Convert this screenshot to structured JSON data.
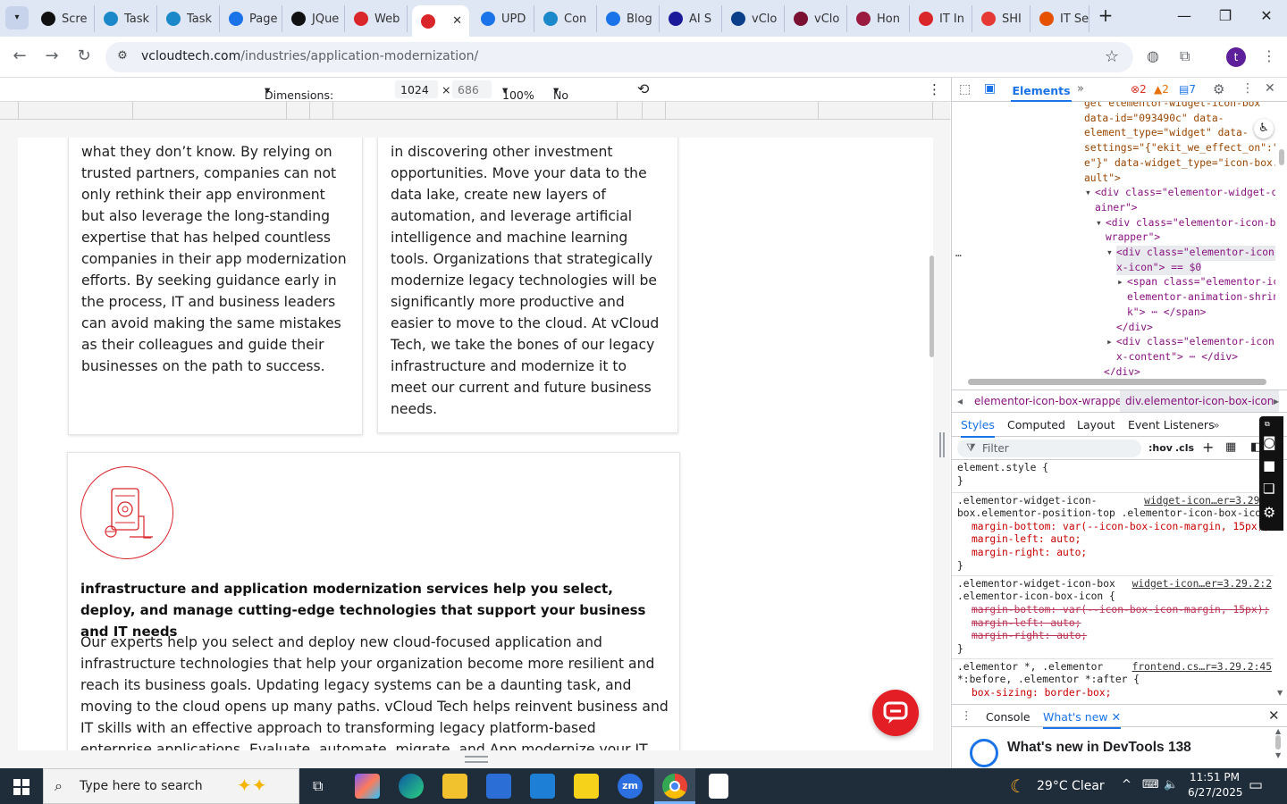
{
  "tabs": [
    {
      "label": "Scre",
      "icon": "github-icon",
      "color": "#111111"
    },
    {
      "label": "Task",
      "icon": "task-hexagon-icon",
      "color": "#1a88c9"
    },
    {
      "label": "Task",
      "icon": "task-hexagon-icon",
      "color": "#1a88c9"
    },
    {
      "label": "Page",
      "icon": "pagespeed-icon",
      "color": "#1a73e8"
    },
    {
      "label": "JQue",
      "icon": "threads-icon",
      "color": "#111111"
    },
    {
      "label": "Web",
      "icon": "vcloud-logo-icon",
      "color": "#d9262b"
    },
    {
      "label": "",
      "icon": "vcloud-logo-icon",
      "color": "#d9262b"
    },
    {
      "label": "UPD",
      "icon": "document-icon",
      "color": "#1a73e8"
    },
    {
      "label": "Con",
      "icon": "hexagon-icon",
      "color": "#1a88c9"
    },
    {
      "label": "Blog",
      "icon": "scale-icon",
      "color": "#1a73e8"
    },
    {
      "label": "AI S",
      "icon": "x-logo-icon",
      "color": "#1a1a9a"
    },
    {
      "label": "vClo",
      "icon": "check-logo-icon",
      "color": "#0b3f8a"
    },
    {
      "label": "vClo",
      "icon": "v-logo-icon",
      "color": "#7a1032"
    },
    {
      "label": "Hon",
      "icon": "vcloud-logo-icon",
      "color": "#9a1b3f"
    },
    {
      "label": "IT In",
      "icon": "vcloud-logo-icon",
      "color": "#d9262b"
    },
    {
      "label": "SHI",
      "icon": "circle-logo-icon",
      "color": "#e53935"
    },
    {
      "label": "IT Se",
      "icon": "slash-logo-icon",
      "color": "#e65100"
    }
  ],
  "tab_close": "✕",
  "new_tab": "+",
  "window": {
    "minimize": "—",
    "restore": "❐",
    "close": "✕"
  },
  "address": {
    "host": "vcloudtech.com",
    "path": "/industries/application-modernization/"
  },
  "device_toolbar": {
    "dimensions_label": "Dimensions: Responsive",
    "width": "1024",
    "times": "×",
    "height": "686",
    "zoom": "100%",
    "throttling": "No throttling"
  },
  "page": {
    "card1_text": "what they don’t know. By relying on\ntrusted partners, companies can not\nonly rethink their app environment\nbut also leverage the long-standing\nexpertise that has helped countless\ncompanies in their app modernization\nefforts. By seeking guidance early in\nthe process, IT and business leaders\ncan avoid making the same mistakes\nas their colleagues and guide their\nbusinesses on the path to success.",
    "card2_text": "in discovering other investment\nopportunities. Move your data to the\ndata lake, create new layers of\nautomation, and leverage artificial\nintelligence and machine learning\ntools. Organizations that strategically\nmodernize legacy technologies will be\nsignificantly more productive and\neasier to move to the cloud. At vCloud\nTech, we take the bones of our legacy\ninfrastructure and modernize it to\nmeet our current and future business\nneeds.",
    "card3_heading": "infrastructure and application modernization services help you select, deploy, and manage cutting-edge technologies that support your business and IT needs",
    "card3_text": "Our experts help you select and deploy new cloud-focused application and\ninfrastructure technologies that help your organization become more resilient and\nreach its business goals. Updating legacy systems can be a daunting task, and\nmoving to the cloud opens up many paths. vCloud Tech helps reinvent business and\nIT skills with an effective approach to transforming legacy platform-based\nenterprise applications. Evaluate, automate, migrate, and App modernize your IT",
    "accent": "#d9262b"
  },
  "devtools": {
    "tab_elements": "Elements",
    "errors": "2",
    "warnings": "2",
    "messages": "7",
    "dom_lines": [
      "get elementor-widget-icon-box\"",
      "data-id=\"093490c\" data-",
      "element_type=\"widget\" data-",
      "settings=\"{\"ekit_we_effect_on\":\"",
      "e\"}\" data-widget_type=\"icon-box.",
      "ault\">",
      "<div class=\"elementor-widget-co",
      "ainer\">",
      "<div class=\"elementor-icon-bo",
      "wrapper\">",
      "<div class=\"elementor-icon-",
      "x-icon\"> == $0",
      "<span class=\"elementor-ic",
      "elementor-animation-shrin",
      "k\"> ⋯ </span>",
      "</div>",
      "<div class=\"elementor-icon-",
      "x-content\"> ⋯ </div>",
      "</div>"
    ],
    "crumb1": "elementor-icon-box-wrapper",
    "crumb2": "div.elementor-icon-box-icon",
    "style_tabs": [
      "Styles",
      "Computed",
      "Layout",
      "Event Listeners"
    ],
    "filter_placeholder": "Filter",
    "hov": ":hov",
    "cls": ".cls",
    "rules": [
      "element.style {",
      "}",
      ".elementor-widget-icon-",
      "box.elementor-position-top .elementor-icon-box-icon",
      "margin-bottom: var(--icon-box-icon-margin, 15px);",
      "margin-left: auto;",
      "margin-right: auto;",
      "}",
      ".elementor-widget-icon-box",
      ".elementor-icon-box-icon {",
      "margin-bottom: var(--icon-box-icon-margin, 15px);",
      "margin-left: auto;",
      "margin-right: auto;",
      "}",
      ".elementor *, .elementor",
      "*:before, .elementor *:after {",
      "box-sizing: border-box;"
    ],
    "sources": [
      "widget-icon…er=3.29.2",
      "widget-icon…er=3.29.2:2",
      "frontend.cs…r=3.29.2:45"
    ],
    "drawer_console": "Console",
    "drawer_whatsnew": "What's new",
    "whatsnew_title": "What's new in DevTools 138"
  },
  "taskbar": {
    "search_placeholder": "Type here to search",
    "weather": "29°C  Clear",
    "time": "11:51 PM",
    "date": "6/27/2025"
  }
}
